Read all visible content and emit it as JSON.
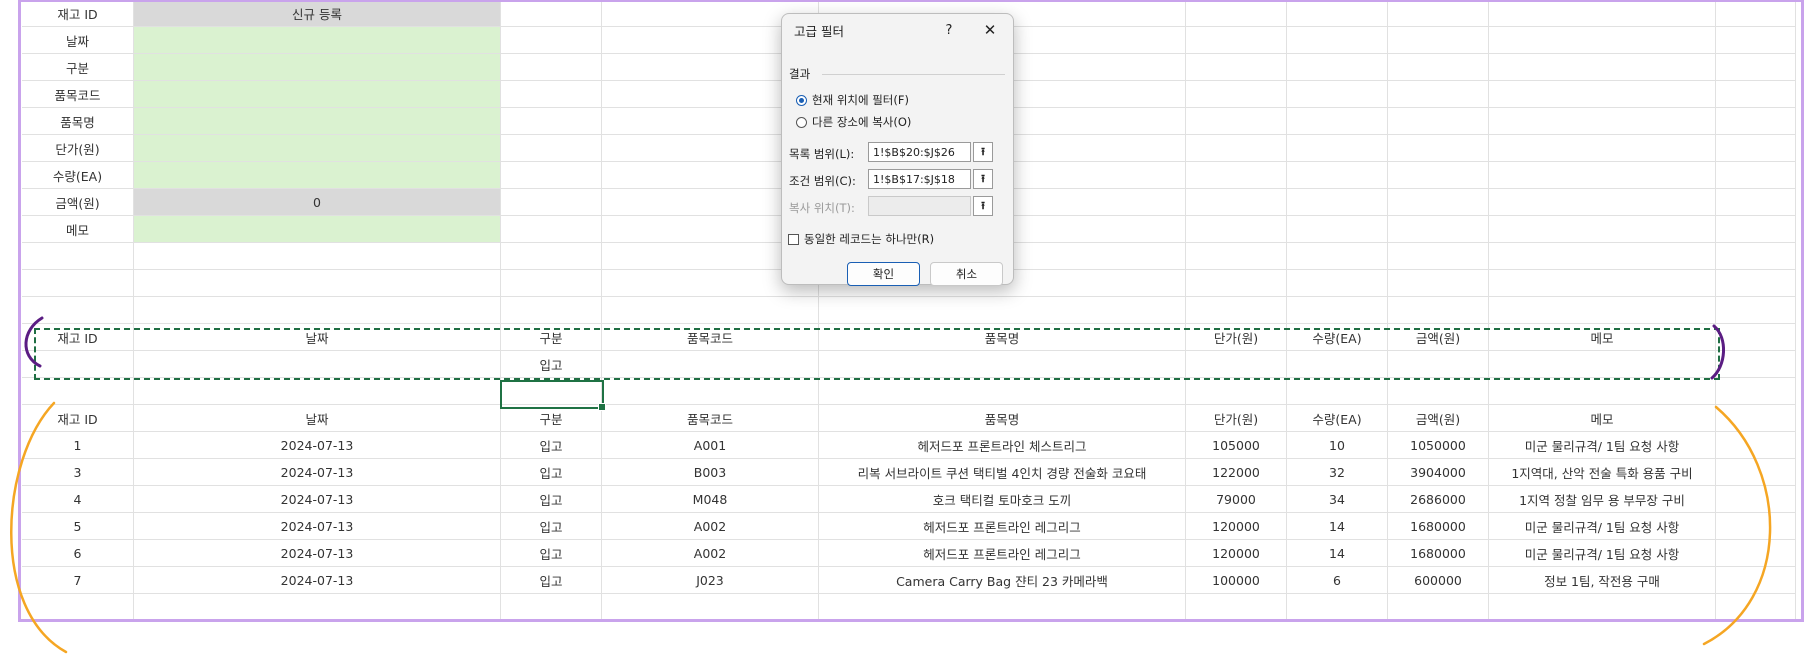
{
  "form": {
    "labels": [
      "재고 ID",
      "날짜",
      "구분",
      "품목코드",
      "품목명",
      "단가(원)",
      "수량(EA)",
      "금액(원)",
      "메모"
    ],
    "values": [
      "신규 등록",
      "",
      "",
      "",
      "",
      "",
      "",
      "0",
      ""
    ]
  },
  "criteria": {
    "headers": [
      "재고 ID",
      "날짜",
      "구분",
      "품목코드",
      "품목명",
      "단가(원)",
      "수량(EA)",
      "금액(원)",
      "메모"
    ],
    "row": [
      "",
      "",
      "입고",
      "",
      "",
      "",
      "",
      "",
      ""
    ]
  },
  "table": {
    "headers": [
      "재고 ID",
      "날짜",
      "구분",
      "품목코드",
      "품목명",
      "단가(원)",
      "수량(EA)",
      "금액(원)",
      "메모"
    ],
    "rows": [
      [
        "1",
        "2024-07-13",
        "입고",
        "A001",
        "헤저드포 프론트라인 체스트리그",
        "105000",
        "10",
        "1050000",
        "미군 물리규격/ 1팀 요청 사항"
      ],
      [
        "3",
        "2024-07-13",
        "입고",
        "B003",
        "리복 서브라이트 쿠션 택티벌 4인치 경량 전술화 코요태",
        "122000",
        "32",
        "3904000",
        "1지역대, 산악 전술 특화 용품 구비"
      ],
      [
        "4",
        "2024-07-13",
        "입고",
        "M048",
        "호크 택티컬 토마호크 도끼",
        "79000",
        "34",
        "2686000",
        "1지역 정찰 임무 용 부무장 구비"
      ],
      [
        "5",
        "2024-07-13",
        "입고",
        "A002",
        "헤저드포 프론트라인 레그리그",
        "120000",
        "14",
        "1680000",
        "미군 물리규격/ 1팀 요청 사항"
      ],
      [
        "6",
        "2024-07-13",
        "입고",
        "A002",
        "헤저드포 프론트라인 레그리그",
        "120000",
        "14",
        "1680000",
        "미군 물리규격/ 1팀 요청 사항"
      ],
      [
        "7",
        "2024-07-13",
        "입고",
        "J023",
        "Camera Carry Bag 쟌티 23 카메라백",
        "100000",
        "6",
        "600000",
        "정보 1팀, 작전용 구매"
      ]
    ]
  },
  "dialog": {
    "title": "고급 필터",
    "help": "?",
    "close": "✕",
    "group_label": "결과",
    "radio_filter_in_place": "현재 위치에 필터(F)",
    "radio_copy_to": "다른 장소에 복사(O)",
    "list_range_label": "목록 범위(L):",
    "list_range_value": "1!$B$20:$J$26",
    "criteria_range_label": "조건 범위(C):",
    "criteria_range_value": "1!$B$17:$J$18",
    "copy_to_label": "복사 위치(T):",
    "copy_to_value": "",
    "unique_label": "동일한 레코드는 하나만(R)",
    "ok": "확인",
    "cancel": "취소",
    "collapse_icon": "⭱"
  },
  "colors": {
    "frame": "#c9a3ec",
    "dashed_border": "#1f6e43",
    "orange_annotation": "#f5a623",
    "purple_annotation": "#5b1d83",
    "input_fill": "#daf2d0",
    "calc_fill": "#d9d9d9"
  }
}
